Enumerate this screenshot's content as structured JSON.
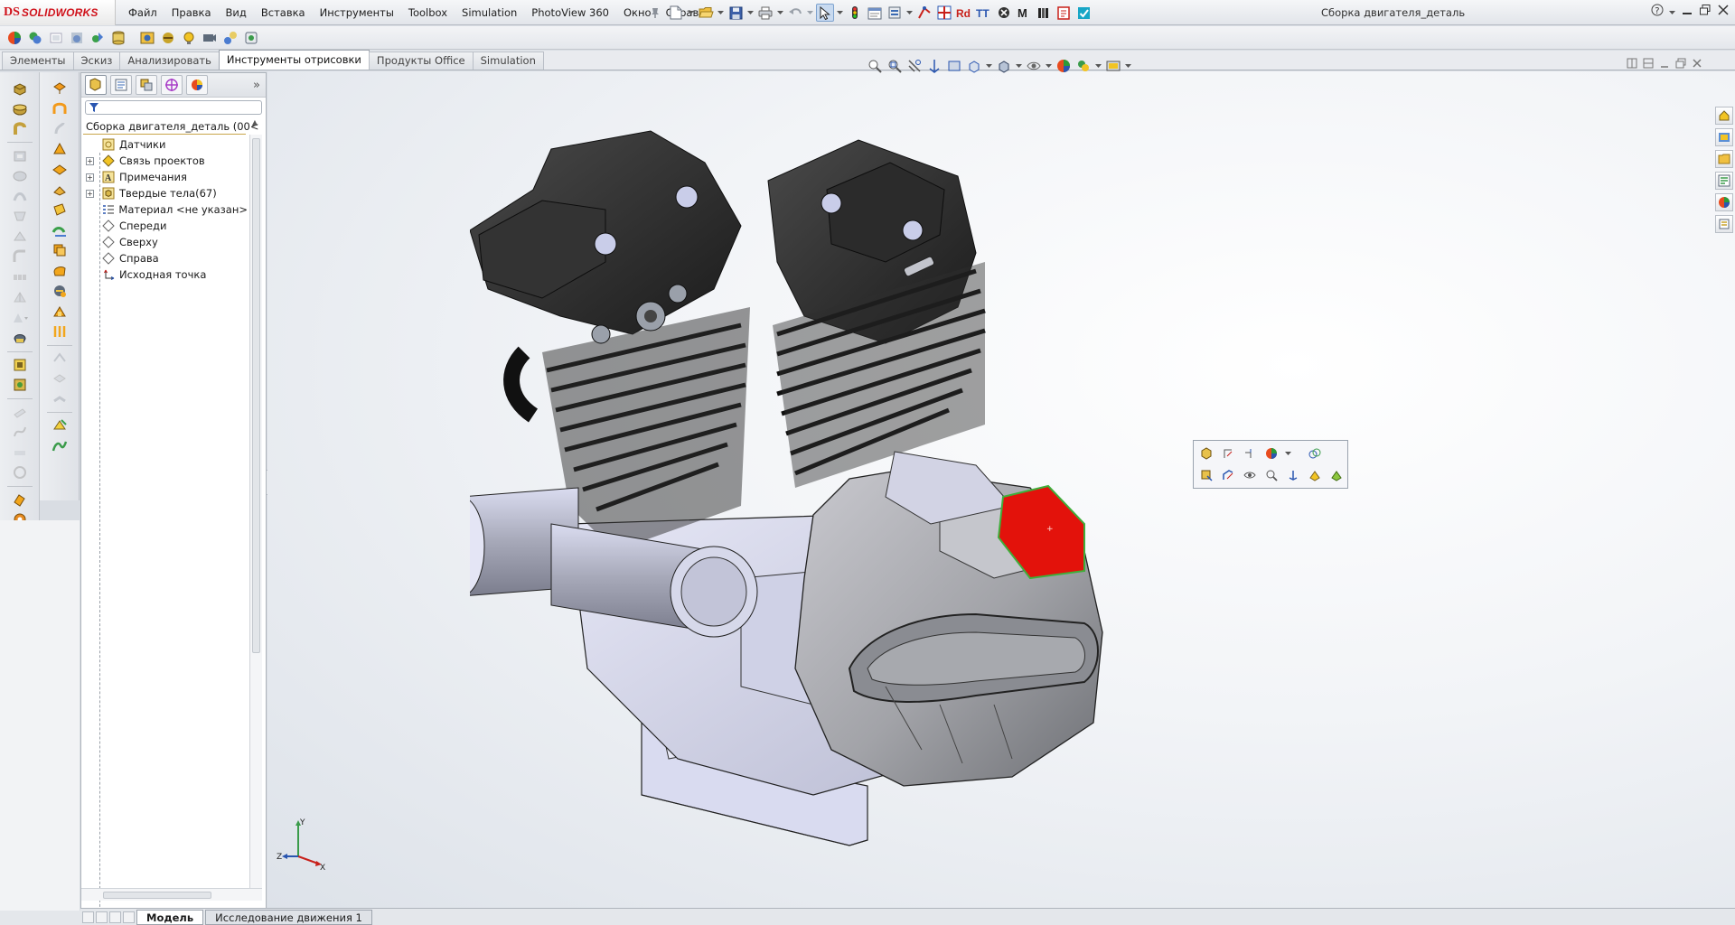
{
  "app": {
    "logo_mark": "DS",
    "logo_name": "SOLIDWORKS",
    "doc_title": "Сборка двигателя_деталь"
  },
  "menu": [
    "Файл",
    "Правка",
    "Вид",
    "Вставка",
    "Инструменты",
    "Toolbox",
    "Simulation",
    "PhotoView 360",
    "Окно",
    "Справка"
  ],
  "command_tabs": [
    {
      "label": "Элементы",
      "active": false
    },
    {
      "label": "Эскиз",
      "active": false
    },
    {
      "label": "Анализировать",
      "active": false
    },
    {
      "label": "Инструменты отрисовки",
      "active": true
    },
    {
      "label": "Продукты Office",
      "active": false
    },
    {
      "label": "Simulation",
      "active": false
    }
  ],
  "feature_tree": {
    "root": "Сборка двигателя_деталь  (00<",
    "items": [
      {
        "label": "Датчики",
        "icon": "sensor-icon",
        "expandable": false
      },
      {
        "label": "Связь проектов",
        "icon": "design-binder-icon",
        "expandable": true
      },
      {
        "label": "Примечания",
        "icon": "annotations-icon",
        "expandable": true
      },
      {
        "label": "Твердые тела(67)",
        "icon": "solid-bodies-icon",
        "expandable": true
      },
      {
        "label": "Материал <не указан>",
        "icon": "material-icon",
        "expandable": false
      },
      {
        "label": "Спереди",
        "icon": "plane-icon",
        "expandable": false
      },
      {
        "label": "Сверху",
        "icon": "plane-icon",
        "expandable": false
      },
      {
        "label": "Справа",
        "icon": "plane-icon",
        "expandable": false
      },
      {
        "label": "Исходная точка",
        "icon": "origin-icon",
        "expandable": false
      }
    ]
  },
  "triad": {
    "x": "X",
    "y": "Y",
    "z": "Z"
  },
  "bottom_tabs": [
    {
      "label": "Модель",
      "active": true
    },
    {
      "label": "Исследование движения 1",
      "active": false
    }
  ],
  "colors": {
    "brand": "#d0121b",
    "selected_face": "#e3120b",
    "viewport_bg": "#eef1f5"
  }
}
